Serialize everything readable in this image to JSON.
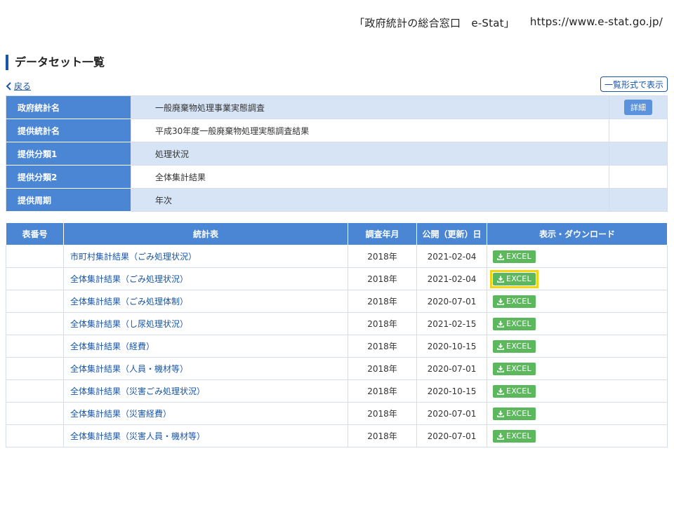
{
  "source": {
    "label": "「政府統計の総合窓口　e-Stat」",
    "url": "https://www.e-stat.go.jp/"
  },
  "page_title": "データセット一覧",
  "back_label": "戻る",
  "list_view_label": "一覧形式で表示",
  "info": {
    "rows": [
      {
        "label": "政府統計名",
        "value": "一般廃棄物処理事業実態調査",
        "action": "詳細"
      },
      {
        "label": "提供統計名",
        "value": "平成30年度一般廃棄物処理実態調査結果"
      },
      {
        "label": "提供分類1",
        "value": "処理状況"
      },
      {
        "label": "提供分類2",
        "value": "全体集計結果"
      },
      {
        "label": "提供周期",
        "value": "年次"
      }
    ]
  },
  "table": {
    "headers": [
      "表番号",
      "統計表",
      "調査年月",
      "公開（更新）日",
      "表示・ダウンロード"
    ],
    "download_label": "EXCEL",
    "rows": [
      {
        "name": "市町村集計結果（ごみ処理状況）",
        "year": "2018年",
        "date": "2021-02-04"
      },
      {
        "name": "全体集計結果（ごみ処理状況）",
        "year": "2018年",
        "date": "2021-02-04",
        "highlight": true
      },
      {
        "name": "全体集計結果（ごみ処理体制）",
        "year": "2018年",
        "date": "2020-07-01"
      },
      {
        "name": "全体集計結果（し尿処理状況）",
        "year": "2018年",
        "date": "2021-02-15"
      },
      {
        "name": "全体集計結果（経費）",
        "year": "2018年",
        "date": "2020-10-15"
      },
      {
        "name": "全体集計結果（人員・機材等）",
        "year": "2018年",
        "date": "2020-07-01"
      },
      {
        "name": "全体集計結果（災害ごみ処理状況）",
        "year": "2018年",
        "date": "2020-10-15"
      },
      {
        "name": "全体集計結果（災害経費）",
        "year": "2018年",
        "date": "2020-07-01"
      },
      {
        "name": "全体集計結果（災害人員・機材等）",
        "year": "2018年",
        "date": "2020-07-01"
      }
    ]
  },
  "colors": {
    "header_blue": "#4a86d4",
    "stripe_blue": "#d6e4f5",
    "excel_green": "#5cb85c",
    "highlight_yellow": "#f5d40f",
    "link_blue": "#1a56a8"
  }
}
